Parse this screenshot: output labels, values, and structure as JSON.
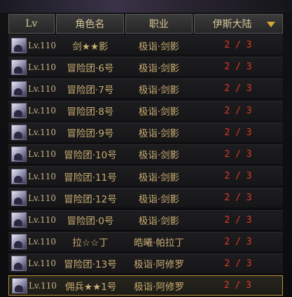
{
  "header": {
    "lv": "Lv",
    "name": "角色名",
    "job": "职业",
    "server": "伊斯大陆"
  },
  "rows": [
    {
      "level": "Lv.110",
      "name": "剑★★影",
      "job": "极诣·剑影",
      "count": "2 / 3"
    },
    {
      "level": "Lv.110",
      "name": "冒险团·6号",
      "job": "极诣·剑影",
      "count": "2 / 3"
    },
    {
      "level": "Lv.110",
      "name": "冒险团·7号",
      "job": "极诣·剑影",
      "count": "2 / 3"
    },
    {
      "level": "Lv.110",
      "name": "冒险团·8号",
      "job": "极诣·剑影",
      "count": "2 / 3"
    },
    {
      "level": "Lv.110",
      "name": "冒险团·9号",
      "job": "极诣·剑影",
      "count": "2 / 3"
    },
    {
      "level": "Lv.110",
      "name": "冒险团·10号",
      "job": "极诣·剑影",
      "count": "2 / 3"
    },
    {
      "level": "Lv.110",
      "name": "冒险团·11号",
      "job": "极诣·剑影",
      "count": "2 / 3"
    },
    {
      "level": "Lv.110",
      "name": "冒险团·12号",
      "job": "极诣·剑影",
      "count": "2 / 3"
    },
    {
      "level": "Lv.110",
      "name": "冒险团·0号",
      "job": "极诣·剑影",
      "count": "2 / 3"
    },
    {
      "level": "Lv.110",
      "name": "拉☆☆丁",
      "job": "皓曦·帕拉丁",
      "count": "2 / 3"
    },
    {
      "level": "Lv.110",
      "name": "冒险团·13号",
      "job": "极诣·阿修罗",
      "count": "2 / 3"
    },
    {
      "level": "Lv.110",
      "name": "佣兵★★1号",
      "job": "极诣·阿修罗",
      "count": "2 / 3"
    }
  ],
  "selected_row": 11,
  "colors": {
    "accent": "#d8c79a",
    "count": "#e03a2a",
    "selected_border": "#b8913b"
  }
}
